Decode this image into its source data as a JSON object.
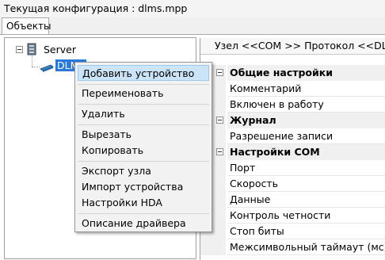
{
  "window": {
    "title": "Текущая конфигурация : dlms.mpp"
  },
  "tabs": [
    {
      "label": "Объекты"
    }
  ],
  "tree": {
    "root": {
      "label": "Server"
    },
    "child": {
      "label": "DLMS"
    }
  },
  "context_menu": {
    "items": [
      {
        "label": "Добавить устройство"
      },
      {
        "label": "Переименовать"
      },
      {
        "label": "Удалить"
      },
      {
        "label": "Вырезать"
      },
      {
        "label": "Копировать"
      },
      {
        "label": "Экспорт узла"
      },
      {
        "label": "Импорт устройства"
      },
      {
        "label": "Настройки HDA"
      },
      {
        "label": "Описание драйвера"
      }
    ]
  },
  "properties": {
    "header": "Узел <<COM  >> Протокол <<DLMS",
    "rows": [
      {
        "label": "Общие настройки"
      },
      {
        "label": "Комментарий"
      },
      {
        "label": "Включен в работу"
      },
      {
        "label": "Журнал"
      },
      {
        "label": "Разрешение записи"
      },
      {
        "label": "Настройки COM"
      },
      {
        "label": "Порт"
      },
      {
        "label": "Скорость"
      },
      {
        "label": "Данные"
      },
      {
        "label": "Контроль четности"
      },
      {
        "label": "Стоп биты"
      },
      {
        "label": "Межсимвольный таймаут (мс)"
      }
    ]
  },
  "colors": {
    "selection": "#2b78d8",
    "menu_highlight": "#cce4f7",
    "menu_highlight_border": "#99c9ef"
  }
}
